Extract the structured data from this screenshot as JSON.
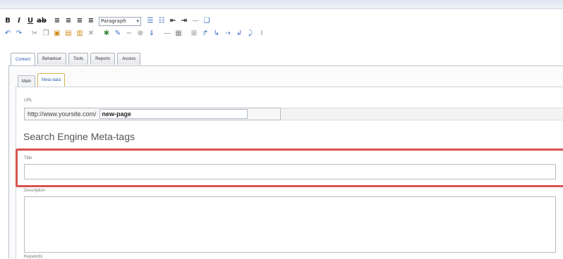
{
  "toolbar": {
    "format_select": {
      "value": "Paragraph"
    }
  },
  "tabs": {
    "main": [
      {
        "label": "Content",
        "active": true
      },
      {
        "label": "Behaviour",
        "active": false
      },
      {
        "label": "Tools",
        "active": false
      },
      {
        "label": "Reports",
        "active": false
      },
      {
        "label": "Access",
        "active": false
      }
    ],
    "sub": [
      {
        "label": "Main",
        "active": false
      },
      {
        "label": "Meta-data",
        "active": true
      }
    ]
  },
  "meta": {
    "url_label": "URL",
    "url_prefix": "http://www.yoursite.com/",
    "url_value": "new-page",
    "section_heading": "Search Engine Meta-tags",
    "title_label": "Title",
    "title_value": "",
    "description_label": "Description",
    "description_value": "",
    "keywords_label": "Keywords"
  },
  "colors": {
    "highlight": "#d9534f",
    "active_tab_text": "#2a5db0"
  }
}
